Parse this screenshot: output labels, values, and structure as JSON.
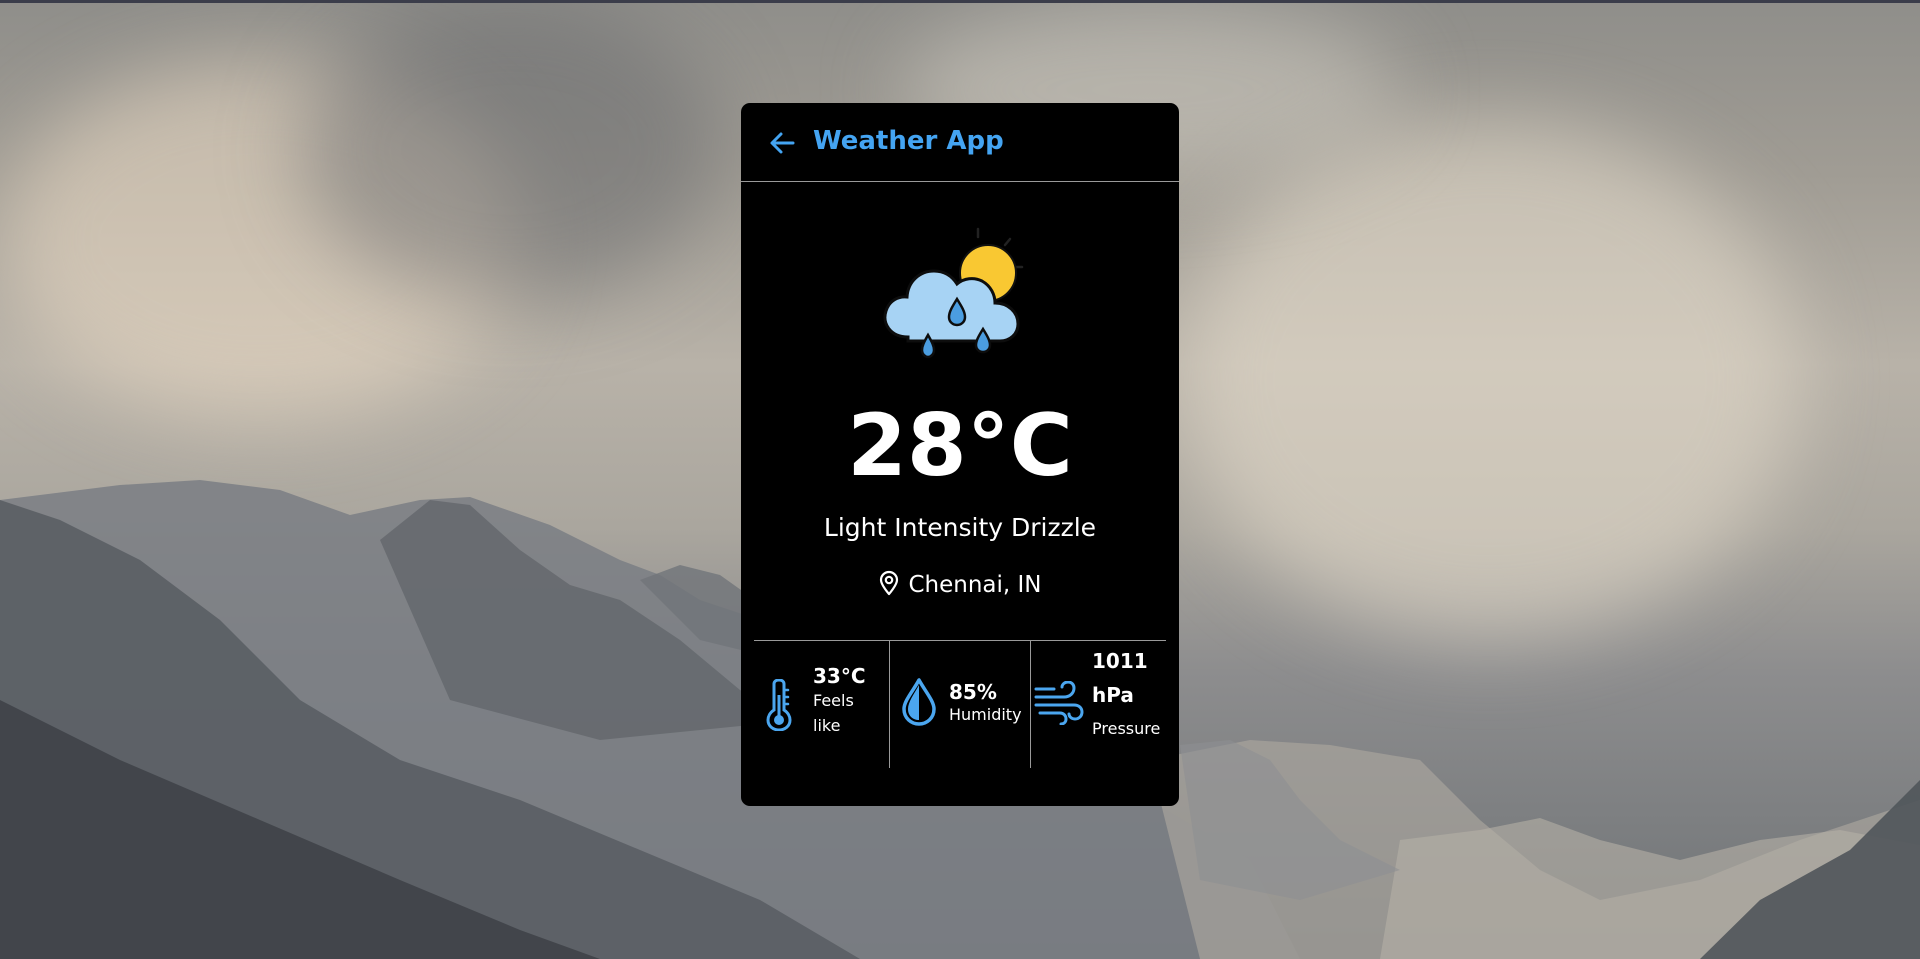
{
  "app": {
    "title": "Weather App",
    "accent_color": "#44a4f2"
  },
  "weather": {
    "icon": "cloud-rain-sun-icon",
    "temperature": "28°C",
    "description": "Light Intensity Drizzle",
    "location": "Chennai, IN"
  },
  "stats": {
    "feels_like": {
      "icon": "thermometer-icon",
      "value": "33°C",
      "label_line1": "Feels",
      "label_line2": "like"
    },
    "humidity": {
      "icon": "water-drop-icon",
      "value": "85%",
      "label": "Humidity"
    },
    "pressure": {
      "icon": "wind-icon",
      "value_line1": "1011",
      "value_line2": "hPa",
      "label": "Pressure"
    }
  }
}
